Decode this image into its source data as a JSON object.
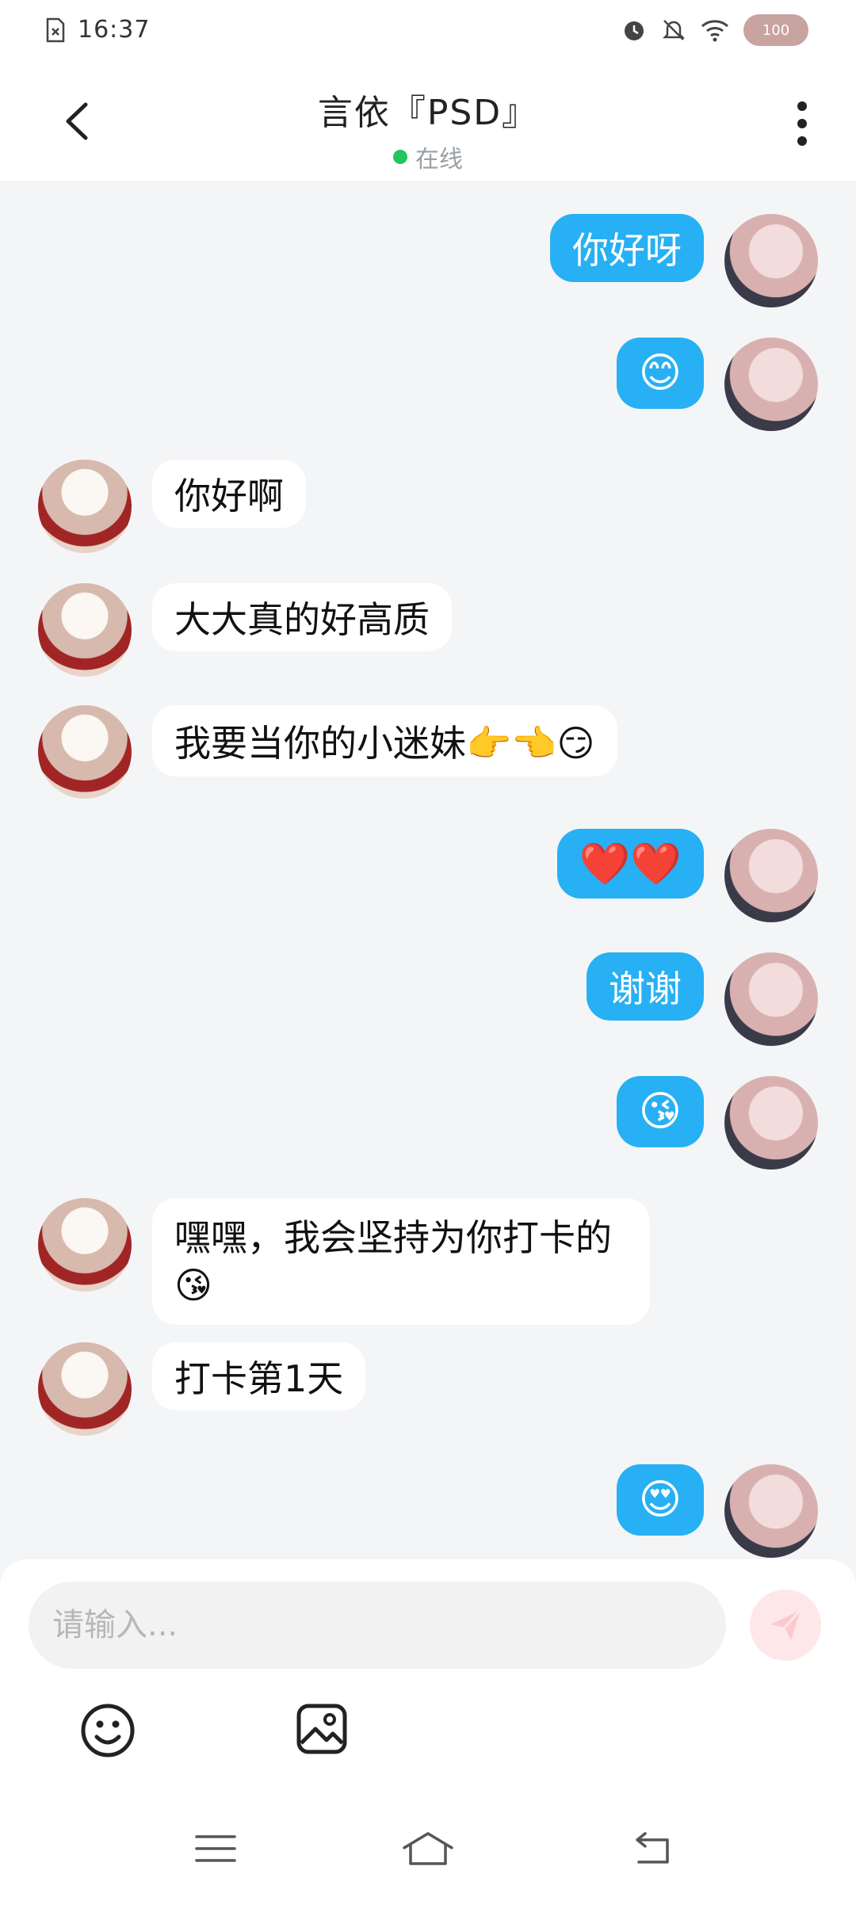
{
  "status_bar": {
    "time": "16:37",
    "battery": "100",
    "icons": [
      "sim-off-icon",
      "alarm-icon",
      "mute-icon",
      "wifi-icon",
      "battery-icon"
    ]
  },
  "header": {
    "title": "言依『PSD』",
    "presence": "在线",
    "presence_color": "#22c55e",
    "back_icon": "chevron-left-icon",
    "more_icon": "more-vertical-icon"
  },
  "messages": [
    {
      "side": "me",
      "text": "你好呀"
    },
    {
      "side": "me",
      "text": "😊"
    },
    {
      "side": "other",
      "text": "你好啊"
    },
    {
      "side": "other",
      "text": "大大真的好高质"
    },
    {
      "side": "other",
      "text": "我要当你的小迷妹👉👈😏"
    },
    {
      "side": "me",
      "text": "❤️❤️"
    },
    {
      "side": "me",
      "text": "谢谢"
    },
    {
      "side": "me",
      "text": "😘"
    },
    {
      "side": "other",
      "text": "嘿嘿，我会坚持为你打卡的😘"
    },
    {
      "side": "other",
      "text": "打卡第1天"
    },
    {
      "side": "me",
      "text": "😍"
    }
  ],
  "composer": {
    "placeholder": "请输入...",
    "send_icon": "send-icon",
    "emoji_tool_icon": "smiley-icon",
    "image_tool_icon": "image-icon"
  },
  "nav": {
    "icons": [
      "menu-icon",
      "home-icon",
      "back-icon"
    ]
  },
  "colors": {
    "my_bubble": "#27b0f3",
    "other_bubble": "#ffffff",
    "background": "#f4f5f7"
  }
}
